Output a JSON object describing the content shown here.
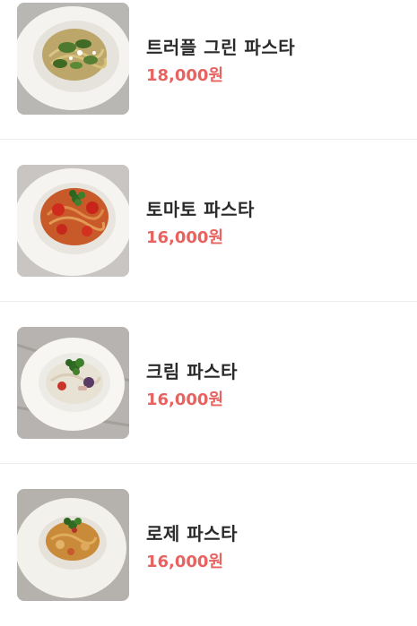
{
  "menu": {
    "items": [
      {
        "name": "트러플 그린 파스타",
        "price": "18,000원",
        "image_icon": "pasta-green-image"
      },
      {
        "name": "토마토 파스타",
        "price": "16,000원",
        "image_icon": "pasta-tomato-image"
      },
      {
        "name": "크림 파스타",
        "price": "16,000원",
        "image_icon": "pasta-cream-image"
      },
      {
        "name": "로제 파스타",
        "price": "16,000원",
        "image_icon": "pasta-rose-image"
      }
    ]
  },
  "colors": {
    "price": "#e8625f",
    "name": "#2a2a2a",
    "divider": "#ececec"
  }
}
